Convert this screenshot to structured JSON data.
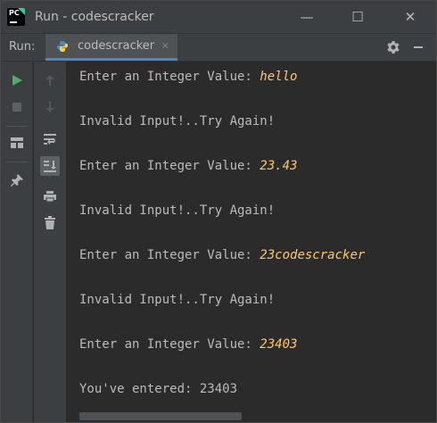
{
  "window": {
    "title": "Run - codescracker",
    "logo_text": "PC",
    "controls": {
      "minimize": "—",
      "maximize": "☐",
      "close": "✕"
    }
  },
  "run_panel": {
    "label": "Run:",
    "tab_label": "codescracker",
    "tab_close": "×"
  },
  "colors": {
    "background": "#2b2b2b",
    "panel": "#3c3f41",
    "text": "#bbbbbb",
    "user_input": "#ffc66d",
    "run_green": "#59a869"
  },
  "console": {
    "lines": [
      {
        "prompt": "Enter an Integer Value: ",
        "input": "hello"
      },
      {
        "text": "Invalid Input!..Try Again!"
      },
      {
        "prompt": "Enter an Integer Value: ",
        "input": "23.43"
      },
      {
        "text": "Invalid Input!..Try Again!"
      },
      {
        "prompt": "Enter an Integer Value: ",
        "input": "23codescracker"
      },
      {
        "text": "Invalid Input!..Try Again!"
      },
      {
        "prompt": "Enter an Integer Value: ",
        "input": "23403"
      },
      {
        "text": "You've entered: 23403"
      }
    ]
  }
}
